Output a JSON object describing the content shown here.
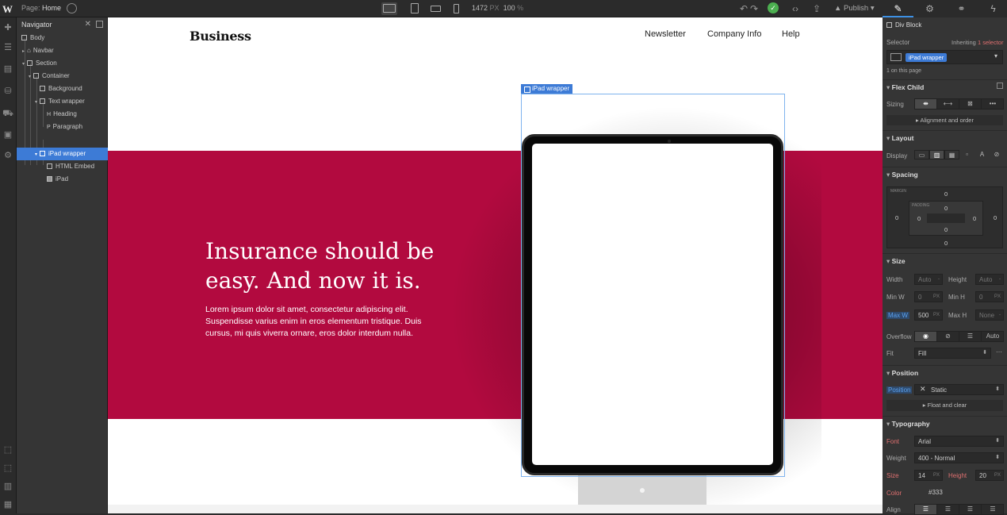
{
  "topbar": {
    "page_label": "Page:",
    "page_name": "Home",
    "width_value": "1472",
    "width_unit": "PX",
    "zoom_value": "100",
    "zoom_unit": "%",
    "publish_label": "Publish"
  },
  "navigator": {
    "title": "Navigator",
    "items": [
      {
        "label": "Body"
      },
      {
        "label": "Navbar"
      },
      {
        "label": "Section"
      },
      {
        "label": "Container"
      },
      {
        "label": "Background"
      },
      {
        "label": "Text wrapper"
      },
      {
        "label": "Heading"
      },
      {
        "label": "Paragraph"
      },
      {
        "label": "iPad wrapper"
      },
      {
        "label": "HTML Embed"
      },
      {
        "label": "iPad"
      }
    ]
  },
  "canvas": {
    "brand": "Business",
    "menu": [
      "Newsletter",
      "Company Info",
      "Help"
    ],
    "hero_line1": "Insurance should be",
    "hero_line2": "easy. And now it is.",
    "paragraph": "Lorem ipsum dolor sit amet, consectetur adipiscing elit. Suspendisse varius enim in eros elementum tristique. Duis cursus, mi quis viverra ornare, eros dolor interdum nulla.",
    "selected_tag": "iPad wrapper",
    "band_color": "#b20a3f"
  },
  "panel": {
    "element_type": "Div Block",
    "selector_label": "Selector",
    "inheriting_label": "Inheriting",
    "inheriting_count": "1 selector",
    "selector_value": "iPad wrapper",
    "on_page": "1 on this page",
    "flex_child": "Flex Child",
    "sizing_label": "Sizing",
    "alignment_order": "Alignment and order",
    "layout": "Layout",
    "display_label": "Display",
    "spacing": "Spacing",
    "margin_label": "MARGIN",
    "padding_label": "PADDING",
    "zero": "0",
    "size": "Size",
    "width_label": "Width",
    "height_label": "Height",
    "auto": "Auto",
    "minw_label": "Min W",
    "minh_label": "Min H",
    "maxw_label": "Max W",
    "maxh_label": "Max H",
    "maxw_value": "500",
    "none": "None",
    "px": "PX",
    "overflow_label": "Overflow",
    "fit_label": "Fit",
    "fit_value": "Fill",
    "position": "Position",
    "position_label": "Position",
    "position_value": "Static",
    "float_clear": "Float and clear",
    "typography": "Typography",
    "font_label": "Font",
    "font_value": "Arial",
    "weight_label": "Weight",
    "weight_value": "400 - Normal",
    "size_label": "Size",
    "size_value": "14",
    "lheight_label": "Height",
    "lheight_value": "20",
    "color_label": "Color",
    "color_value": "#333",
    "align_label": "Align",
    "accent": "#3d7bd6"
  }
}
